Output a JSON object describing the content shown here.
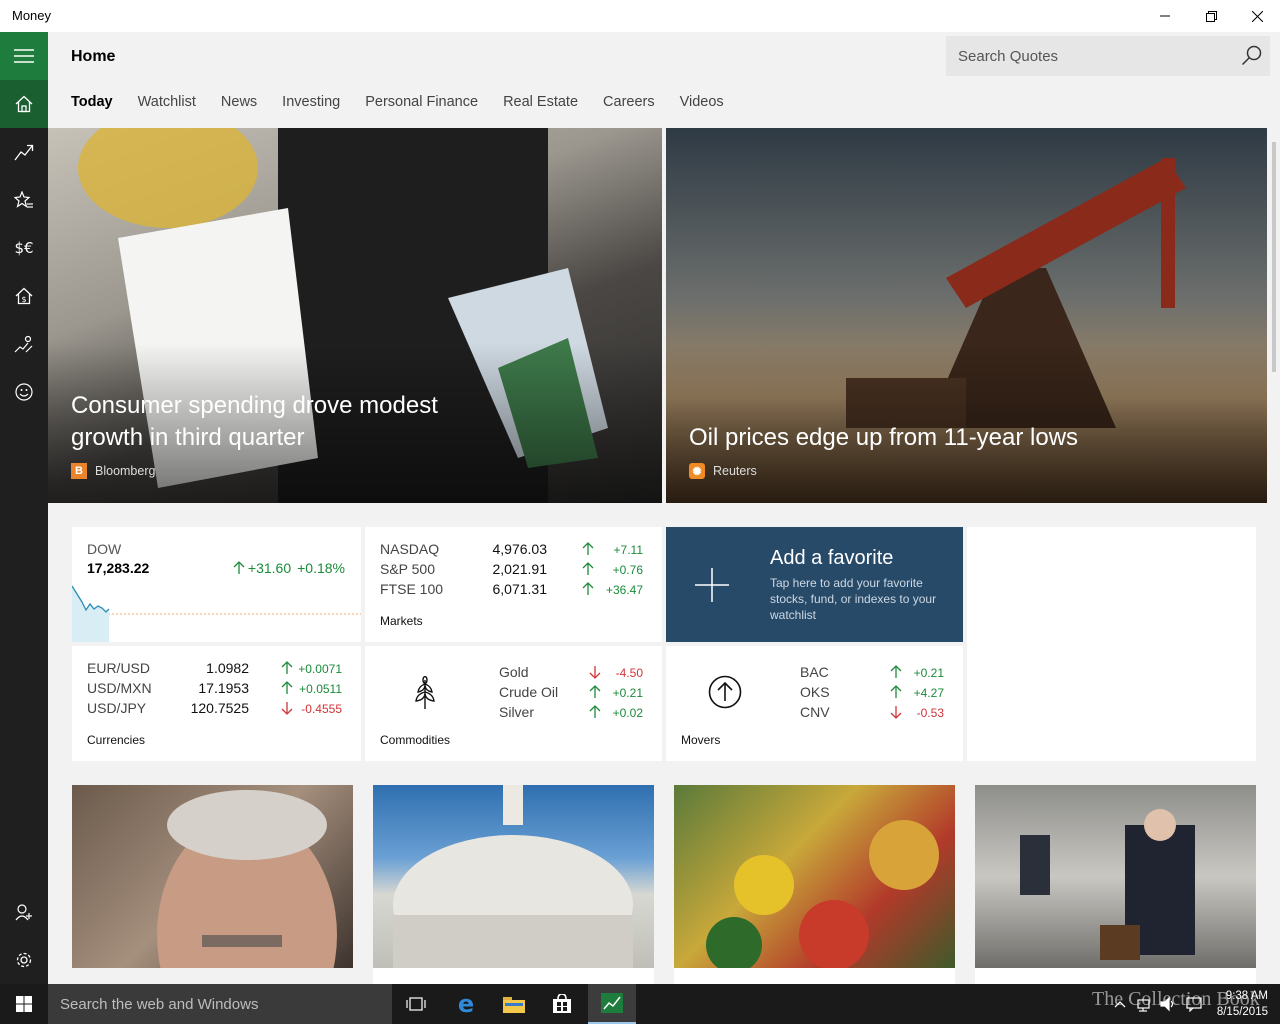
{
  "window": {
    "title": "Money"
  },
  "header": {
    "page_title": "Home",
    "search_placeholder": "Search Quotes"
  },
  "tabs": [
    {
      "label": "Today"
    },
    {
      "label": "Watchlist"
    },
    {
      "label": "News"
    },
    {
      "label": "Investing"
    },
    {
      "label": "Personal Finance"
    },
    {
      "label": "Real Estate"
    },
    {
      "label": "Careers"
    },
    {
      "label": "Videos"
    }
  ],
  "rail": {
    "items": [
      {
        "icon": "hamburger-menu-icon"
      },
      {
        "icon": "home-icon"
      },
      {
        "icon": "trend-chart-icon"
      },
      {
        "icon": "watchlist-star-icon"
      },
      {
        "icon": "currency-icon"
      },
      {
        "icon": "mortgage-house-icon"
      },
      {
        "icon": "retirement-icon"
      },
      {
        "icon": "smiley-feedback-icon"
      },
      {
        "icon": "add-account-icon"
      },
      {
        "icon": "settings-gear-icon"
      }
    ]
  },
  "hero": [
    {
      "headline": "Consumer spending drove modest growth in third quarter",
      "source": "Bloomberg",
      "source_color": "#e8852c"
    },
    {
      "headline": "Oil prices edge up from 11-year lows",
      "source": "Reuters",
      "source_color": "#f08a24"
    }
  ],
  "dow": {
    "name": "DOW",
    "value": "17,283.22",
    "change": "+31.60",
    "percent": "+0.18%"
  },
  "markets": {
    "label": "Markets",
    "rows": [
      {
        "name": "NASDAQ",
        "value": "4,976.03",
        "change": "+7.11",
        "direction": "up"
      },
      {
        "name": "S&P 500",
        "value": "2,021.91",
        "change": "+0.76",
        "direction": "up"
      },
      {
        "name": "FTSE 100",
        "value": "6,071.31",
        "change": "+36.47",
        "direction": "up"
      }
    ]
  },
  "favorite": {
    "title": "Add a favorite",
    "description": "Tap here to add your favorite stocks, fund, or indexes to your watchlist"
  },
  "currencies": {
    "label": "Currencies",
    "rows": [
      {
        "name": "EUR/USD",
        "value": "1.0982",
        "change": "+0.0071",
        "direction": "up"
      },
      {
        "name": "USD/MXN",
        "value": "17.1953",
        "change": "+0.0511",
        "direction": "up"
      },
      {
        "name": "USD/JPY",
        "value": "120.7525",
        "change": "-0.4555",
        "direction": "down"
      }
    ]
  },
  "commodities": {
    "label": "Commodities",
    "rows": [
      {
        "name": "Gold",
        "change": "-4.50",
        "direction": "down"
      },
      {
        "name": "Crude Oil",
        "change": "+0.21",
        "direction": "up"
      },
      {
        "name": "Silver",
        "change": "+0.02",
        "direction": "up"
      }
    ]
  },
  "movers": {
    "label": "Movers",
    "rows": [
      {
        "name": "BAC",
        "change": "+0.21",
        "direction": "up"
      },
      {
        "name": "OKS",
        "change": "+4.27",
        "direction": "up"
      },
      {
        "name": "CNV",
        "change": "-0.53",
        "direction": "down"
      }
    ]
  },
  "taskbar": {
    "search_placeholder": "Search the web and Windows",
    "time": "9:38 AM",
    "date": "8/15/2015",
    "watermark": "The Collection Book"
  },
  "colors": {
    "accent": "#1e7c3c",
    "favorite_tile": "#274a69",
    "up": "#1b8b3a",
    "down": "#d13438"
  }
}
